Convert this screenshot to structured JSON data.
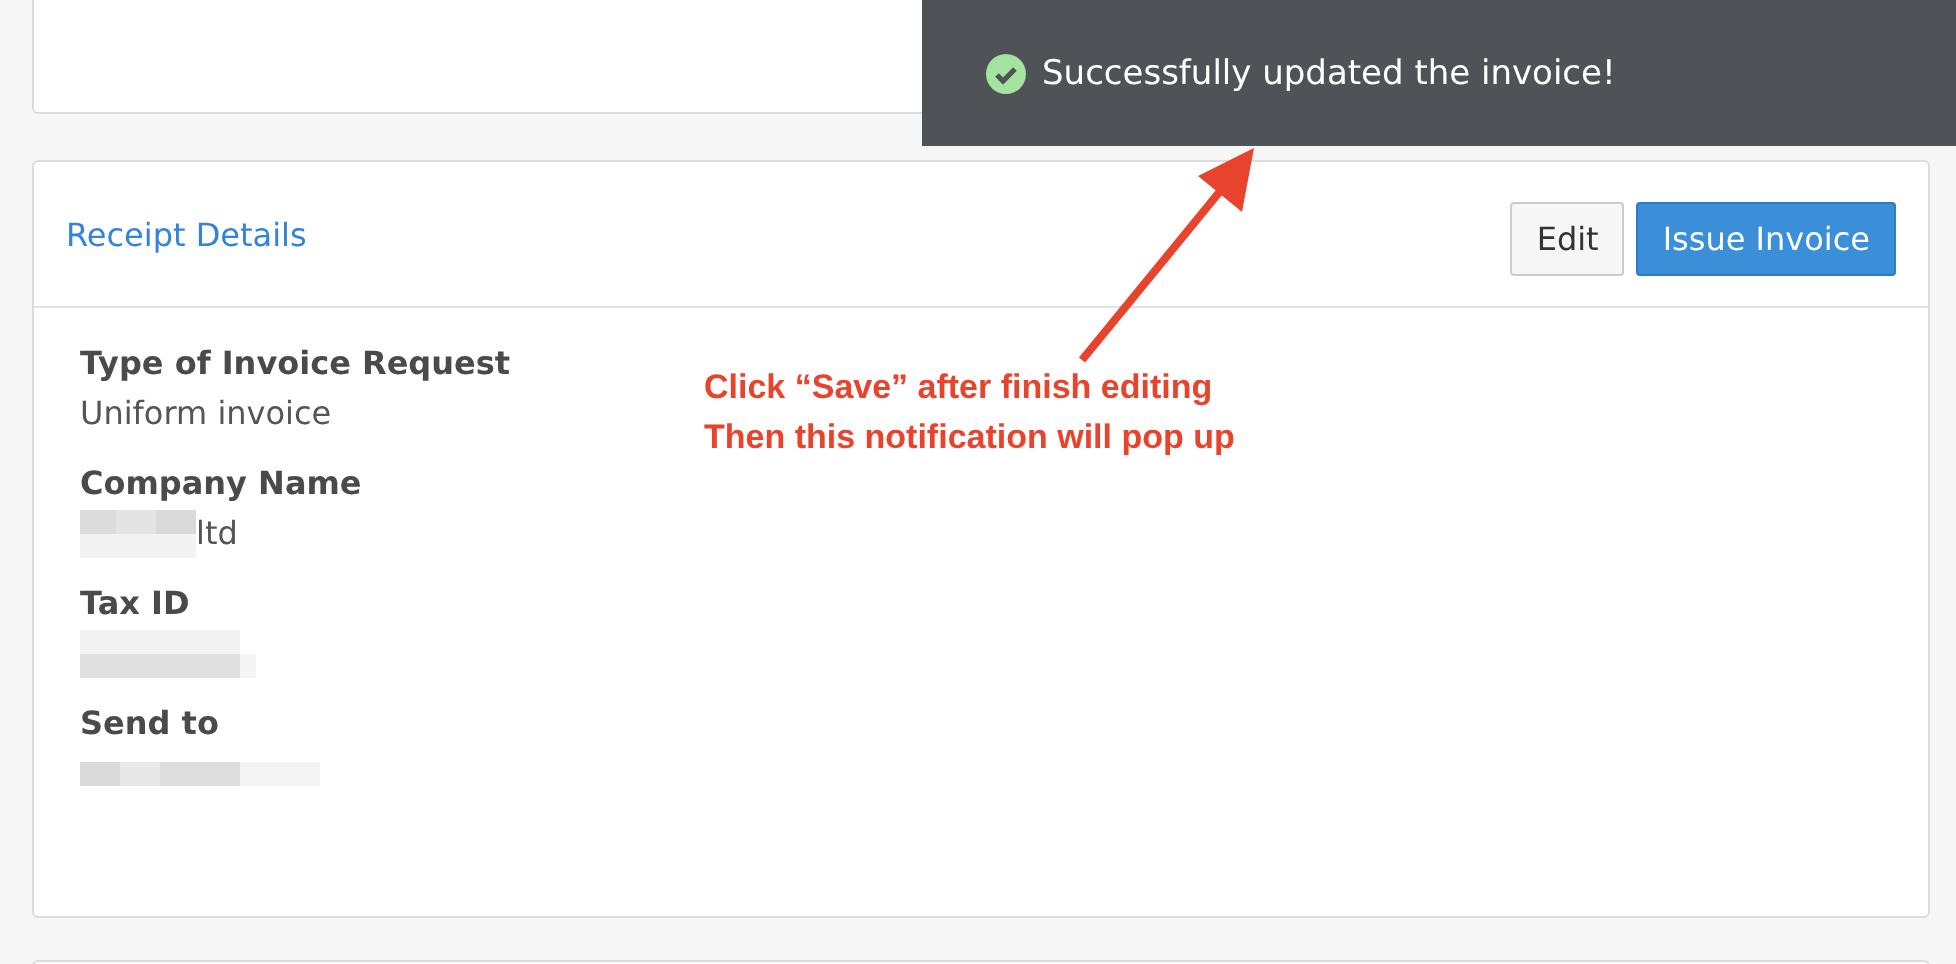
{
  "toast": {
    "message": "Successfully updated the invoice!"
  },
  "receipt": {
    "title": "Receipt Details",
    "buttons": [
      {
        "label": "Edit",
        "kind": "default"
      },
      {
        "label": "Issue Invoice",
        "kind": "primary"
      }
    ],
    "fields": [
      {
        "label": "Type of Invoice Request",
        "value": "Uniform invoice",
        "redacted": false
      },
      {
        "label": "Company Name",
        "value": "ltd",
        "redacted": true
      },
      {
        "label": "Tax ID",
        "redacted": true
      },
      {
        "label": "Send to",
        "redacted": true
      }
    ]
  },
  "annotation": {
    "lines": [
      "Click “Save” after finish editing",
      "Then this notification will pop up"
    ]
  }
}
